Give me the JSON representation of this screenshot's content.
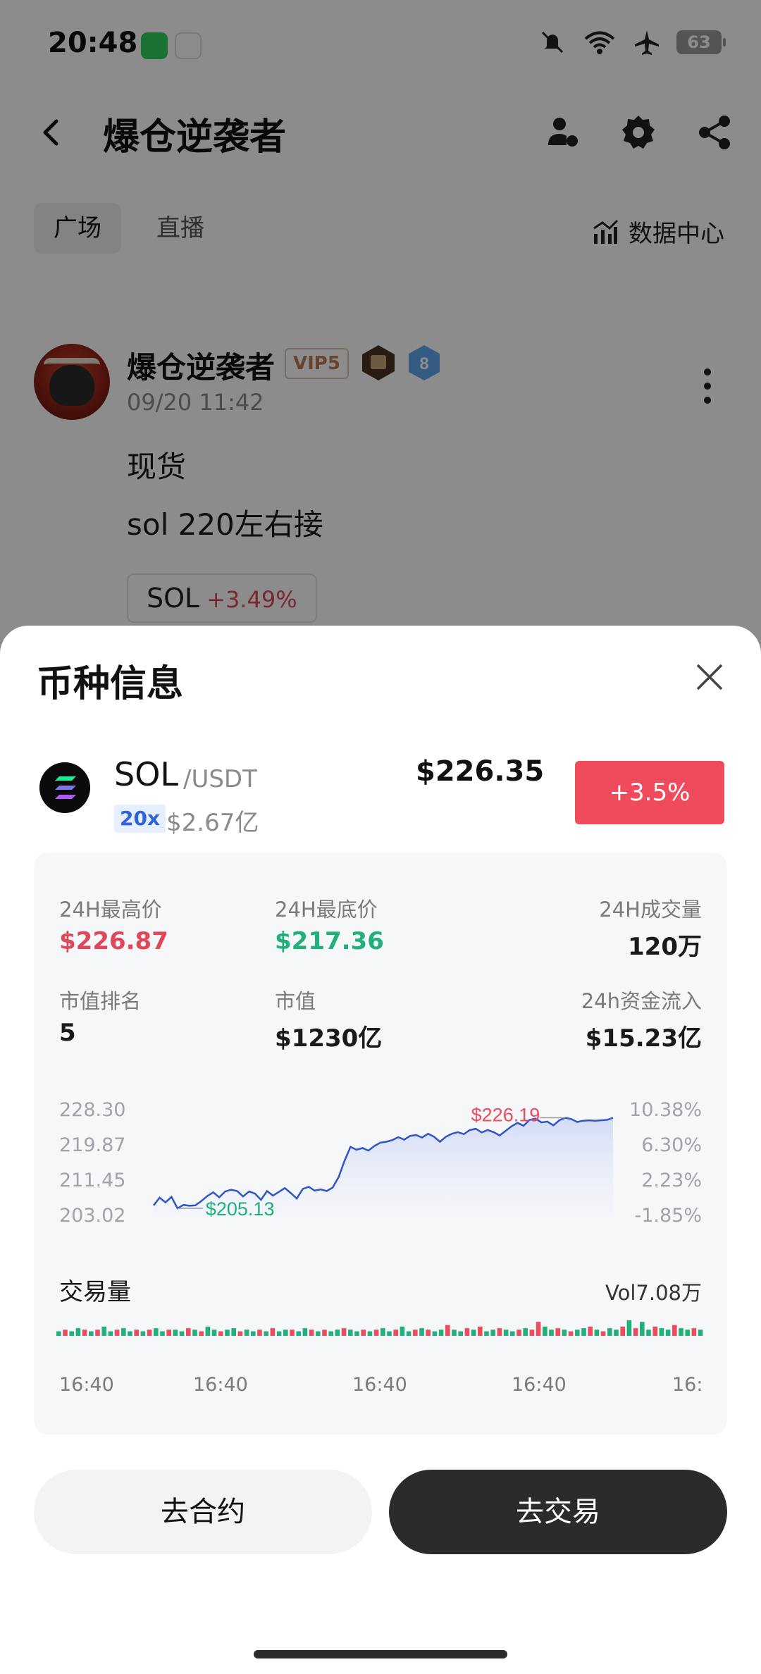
{
  "status_bar": {
    "time": "20:48",
    "battery": "63",
    "icons": [
      "messages-app-icon",
      "gallery-app-icon",
      "mute-icon",
      "wifi-icon",
      "airplane-icon",
      "battery-icon"
    ]
  },
  "nav": {
    "title": "爆仓逆袭者",
    "icons": [
      "back-icon",
      "user-settings-icon",
      "gear-icon",
      "share-icon"
    ]
  },
  "tabs": [
    {
      "label": "广场",
      "active": true
    },
    {
      "label": "直播",
      "active": false
    }
  ],
  "data_center": {
    "label": "数据中心"
  },
  "post": {
    "author": "爆仓逆袭者",
    "vip": "VIP5",
    "level": "8",
    "time": "09/20 11:42",
    "lines": [
      "现货",
      "sol 220左右接"
    ],
    "coin_chip": {
      "symbol": "SOL",
      "change": "+3.49%"
    }
  },
  "sheet": {
    "title": "币种信息",
    "coin": {
      "symbol": "SOL",
      "quote": "/USDT",
      "leverage": "20x",
      "volume": "$2.67亿",
      "price": "$226.35",
      "change": "+3.5%"
    },
    "stats": {
      "high_label": "24H最高价",
      "high_value": "$226.87",
      "low_label": "24H最底价",
      "low_value": "$217.36",
      "volume_label": "24H成交量",
      "volume_value": "120万",
      "rank_label": "市值排名",
      "rank_value": "5",
      "mcap_label": "市值",
      "mcap_value": "$1230亿",
      "flow_label": "24h资金流入",
      "flow_value": "$15.23亿"
    },
    "volume_section": {
      "title": "交易量",
      "value": "Vol7.08万"
    },
    "buttons": {
      "contract": "去合约",
      "trade": "去交易"
    }
  },
  "colors": {
    "up_red": "#ef4b5c",
    "down_green": "#21b07a",
    "line_blue": "#2f55c9",
    "dark_button": "#2b2b2e"
  },
  "chart_data": [
    {
      "type": "line",
      "y_left_ticks": [
        "228.30",
        "219.87",
        "211.45",
        "203.02"
      ],
      "y_right_ticks": [
        "10.38%",
        "6.30%",
        "2.23%",
        "-1.85%"
      ],
      "ylim": [
        203.02,
        228.3
      ],
      "max_label": "$226.19",
      "min_label": "$205.13",
      "series": [
        {
          "values": [
            205.4,
            207.2,
            206.1,
            207.4,
            204.7,
            205.5,
            205.3,
            205.4,
            206.4,
            207.6,
            208.5,
            207.3,
            208.7,
            209.1,
            208.8,
            207.5,
            208.7,
            208.2,
            206.7,
            208.8,
            207.7,
            208.6,
            209.5,
            208.3,
            207.0,
            209.3,
            209.8,
            208.9,
            209.2,
            208.8,
            209.6,
            212.1,
            216.0,
            219.3,
            218.6,
            219.0,
            218.4,
            219.5,
            220.3,
            220.5,
            220.9,
            221.6,
            221.0,
            221.9,
            222.1,
            221.5,
            222.4,
            221.7,
            220.5,
            221.7,
            222.4,
            222.8,
            222.3,
            223.3,
            223.6,
            222.7,
            223.3,
            222.8,
            222.0,
            223.1,
            224.2,
            225.0,
            224.3,
            225.7,
            226.0,
            225.1,
            225.3,
            224.4,
            225.6,
            226.2,
            225.9,
            225.2,
            225.5,
            225.6,
            225.5,
            225.6,
            225.7,
            226.2
          ]
        }
      ]
    },
    {
      "type": "bar",
      "title": "交易量",
      "x_ticks": [
        "16:40",
        "16:40",
        "16:40",
        "16:40",
        "16:"
      ],
      "series": [
        {
          "values": [
            2,
            3,
            2,
            4,
            3,
            2,
            3,
            5,
            2,
            3,
            4,
            2,
            3,
            2,
            3,
            4,
            2,
            3,
            3,
            2,
            4,
            3,
            2,
            5,
            3,
            2,
            3,
            4,
            2,
            3,
            2,
            3,
            2,
            4,
            2,
            3,
            3,
            2,
            4,
            3,
            2,
            3,
            2,
            3,
            4,
            3,
            2,
            3,
            2,
            3,
            4,
            2,
            3,
            5,
            2,
            3,
            4,
            3,
            2,
            3,
            6,
            3,
            2,
            4,
            3,
            5,
            2,
            3,
            4,
            3,
            2,
            3,
            4,
            3,
            8,
            5,
            3,
            4,
            3,
            2,
            3,
            4,
            5,
            3,
            2,
            4,
            3,
            5,
            9,
            4,
            8,
            3,
            5,
            4,
            3,
            6,
            4,
            3,
            4,
            3
          ],
          "up": [
            1,
            0,
            1,
            1,
            0,
            1,
            0,
            1,
            1,
            0,
            1,
            1,
            0,
            1,
            0,
            1,
            1,
            0,
            1,
            1,
            0,
            1,
            0,
            1,
            1,
            0,
            1,
            1,
            0,
            1,
            1,
            0,
            1,
            0,
            1,
            1,
            0,
            1,
            1,
            0,
            1,
            0,
            1,
            1,
            0,
            1,
            1,
            0,
            1,
            0,
            1,
            1,
            0,
            1,
            1,
            0,
            1,
            0,
            1,
            1,
            0,
            1,
            1,
            0,
            1,
            0,
            1,
            1,
            0,
            1,
            1,
            0,
            1,
            0,
            0,
            1,
            1,
            0,
            1,
            0,
            1,
            1,
            0,
            1,
            0,
            1,
            1,
            0,
            1,
            0,
            1,
            1,
            0,
            1,
            1,
            0,
            1,
            1,
            0,
            1
          ]
        }
      ]
    }
  ]
}
